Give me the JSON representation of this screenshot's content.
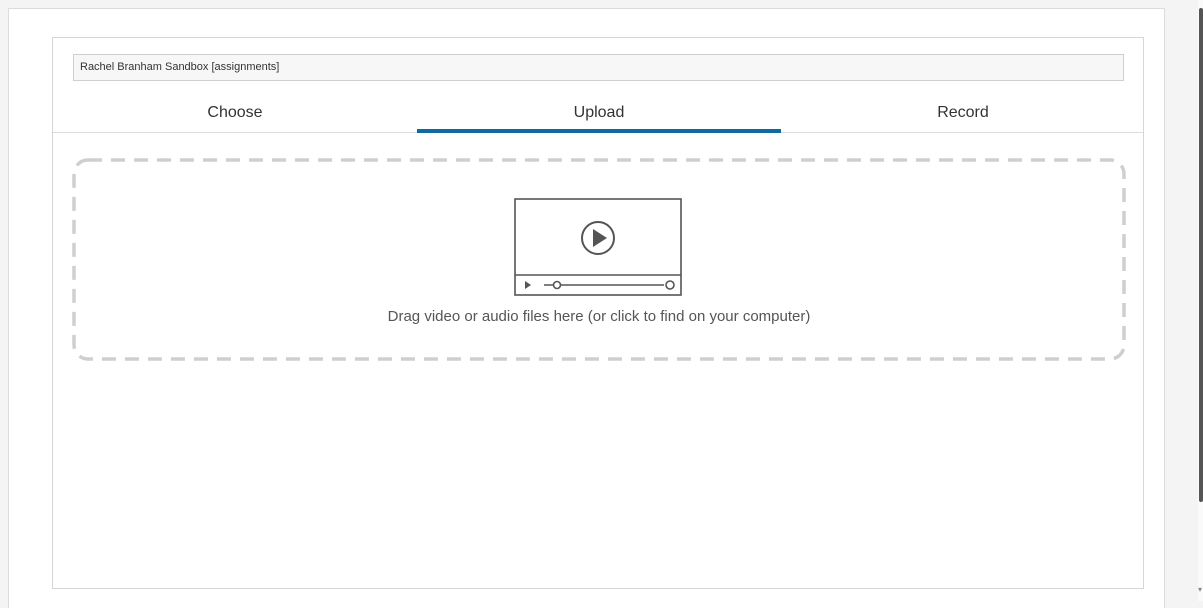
{
  "context": {
    "label": "Rachel Branham Sandbox [assignments]"
  },
  "tabs": [
    {
      "label": "Choose",
      "active": false
    },
    {
      "label": "Upload",
      "active": true
    },
    {
      "label": "Record",
      "active": false
    }
  ],
  "dropzone": {
    "icon": "video-player-icon",
    "text": "Drag video or audio files here (or click to find on your computer)"
  },
  "colors": {
    "accent": "#0f6aa2",
    "dashed_border": "#cfcfcf",
    "icon_stroke": "#555555"
  }
}
